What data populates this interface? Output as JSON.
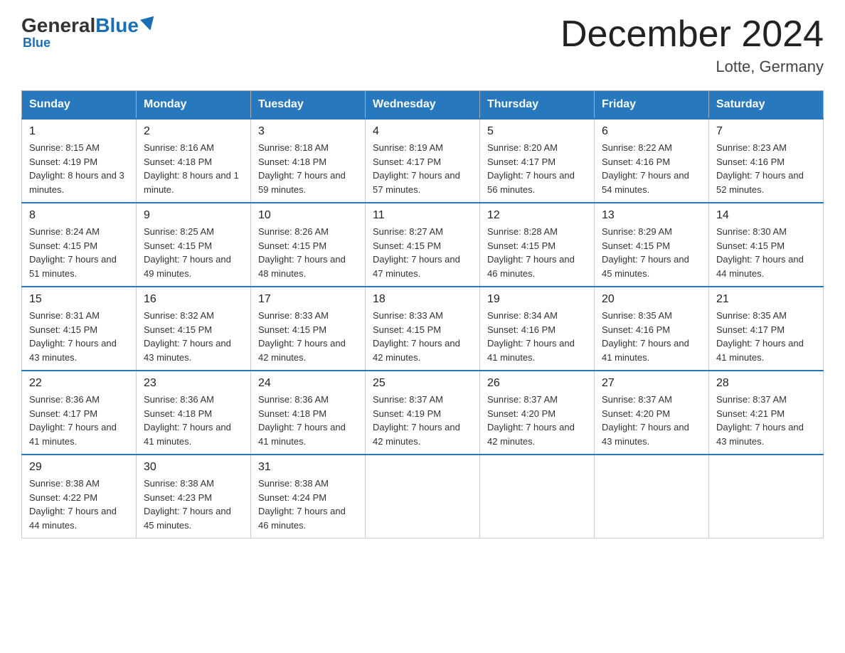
{
  "header": {
    "logo_general": "General",
    "logo_blue": "Blue",
    "month_title": "December 2024",
    "location": "Lotte, Germany"
  },
  "days_of_week": [
    "Sunday",
    "Monday",
    "Tuesday",
    "Wednesday",
    "Thursday",
    "Friday",
    "Saturday"
  ],
  "weeks": [
    [
      {
        "day": "1",
        "sunrise": "8:15 AM",
        "sunset": "4:19 PM",
        "daylight": "8 hours and 3 minutes."
      },
      {
        "day": "2",
        "sunrise": "8:16 AM",
        "sunset": "4:18 PM",
        "daylight": "8 hours and 1 minute."
      },
      {
        "day": "3",
        "sunrise": "8:18 AM",
        "sunset": "4:18 PM",
        "daylight": "7 hours and 59 minutes."
      },
      {
        "day": "4",
        "sunrise": "8:19 AM",
        "sunset": "4:17 PM",
        "daylight": "7 hours and 57 minutes."
      },
      {
        "day": "5",
        "sunrise": "8:20 AM",
        "sunset": "4:17 PM",
        "daylight": "7 hours and 56 minutes."
      },
      {
        "day": "6",
        "sunrise": "8:22 AM",
        "sunset": "4:16 PM",
        "daylight": "7 hours and 54 minutes."
      },
      {
        "day": "7",
        "sunrise": "8:23 AM",
        "sunset": "4:16 PM",
        "daylight": "7 hours and 52 minutes."
      }
    ],
    [
      {
        "day": "8",
        "sunrise": "8:24 AM",
        "sunset": "4:15 PM",
        "daylight": "7 hours and 51 minutes."
      },
      {
        "day": "9",
        "sunrise": "8:25 AM",
        "sunset": "4:15 PM",
        "daylight": "7 hours and 49 minutes."
      },
      {
        "day": "10",
        "sunrise": "8:26 AM",
        "sunset": "4:15 PM",
        "daylight": "7 hours and 48 minutes."
      },
      {
        "day": "11",
        "sunrise": "8:27 AM",
        "sunset": "4:15 PM",
        "daylight": "7 hours and 47 minutes."
      },
      {
        "day": "12",
        "sunrise": "8:28 AM",
        "sunset": "4:15 PM",
        "daylight": "7 hours and 46 minutes."
      },
      {
        "day": "13",
        "sunrise": "8:29 AM",
        "sunset": "4:15 PM",
        "daylight": "7 hours and 45 minutes."
      },
      {
        "day": "14",
        "sunrise": "8:30 AM",
        "sunset": "4:15 PM",
        "daylight": "7 hours and 44 minutes."
      }
    ],
    [
      {
        "day": "15",
        "sunrise": "8:31 AM",
        "sunset": "4:15 PM",
        "daylight": "7 hours and 43 minutes."
      },
      {
        "day": "16",
        "sunrise": "8:32 AM",
        "sunset": "4:15 PM",
        "daylight": "7 hours and 43 minutes."
      },
      {
        "day": "17",
        "sunrise": "8:33 AM",
        "sunset": "4:15 PM",
        "daylight": "7 hours and 42 minutes."
      },
      {
        "day": "18",
        "sunrise": "8:33 AM",
        "sunset": "4:15 PM",
        "daylight": "7 hours and 42 minutes."
      },
      {
        "day": "19",
        "sunrise": "8:34 AM",
        "sunset": "4:16 PM",
        "daylight": "7 hours and 41 minutes."
      },
      {
        "day": "20",
        "sunrise": "8:35 AM",
        "sunset": "4:16 PM",
        "daylight": "7 hours and 41 minutes."
      },
      {
        "day": "21",
        "sunrise": "8:35 AM",
        "sunset": "4:17 PM",
        "daylight": "7 hours and 41 minutes."
      }
    ],
    [
      {
        "day": "22",
        "sunrise": "8:36 AM",
        "sunset": "4:17 PM",
        "daylight": "7 hours and 41 minutes."
      },
      {
        "day": "23",
        "sunrise": "8:36 AM",
        "sunset": "4:18 PM",
        "daylight": "7 hours and 41 minutes."
      },
      {
        "day": "24",
        "sunrise": "8:36 AM",
        "sunset": "4:18 PM",
        "daylight": "7 hours and 41 minutes."
      },
      {
        "day": "25",
        "sunrise": "8:37 AM",
        "sunset": "4:19 PM",
        "daylight": "7 hours and 42 minutes."
      },
      {
        "day": "26",
        "sunrise": "8:37 AM",
        "sunset": "4:20 PM",
        "daylight": "7 hours and 42 minutes."
      },
      {
        "day": "27",
        "sunrise": "8:37 AM",
        "sunset": "4:20 PM",
        "daylight": "7 hours and 43 minutes."
      },
      {
        "day": "28",
        "sunrise": "8:37 AM",
        "sunset": "4:21 PM",
        "daylight": "7 hours and 43 minutes."
      }
    ],
    [
      {
        "day": "29",
        "sunrise": "8:38 AM",
        "sunset": "4:22 PM",
        "daylight": "7 hours and 44 minutes."
      },
      {
        "day": "30",
        "sunrise": "8:38 AM",
        "sunset": "4:23 PM",
        "daylight": "7 hours and 45 minutes."
      },
      {
        "day": "31",
        "sunrise": "8:38 AM",
        "sunset": "4:24 PM",
        "daylight": "7 hours and 46 minutes."
      },
      null,
      null,
      null,
      null
    ]
  ]
}
